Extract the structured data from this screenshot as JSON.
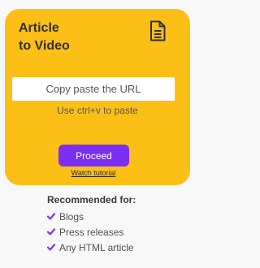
{
  "card": {
    "title_line1": "Article",
    "title_line2": "to Video",
    "icon": "document-icon",
    "url_placeholder": "Copy paste the URL",
    "hint": "Use ctrl+v to paste",
    "proceed_label": "Proceed",
    "watch_tutorial": "Watch tutorial"
  },
  "recommended": {
    "title": "Recommended for:",
    "items": [
      {
        "label": "Blogs",
        "icon": "check-icon"
      },
      {
        "label": "Press releases",
        "icon": "check-icon"
      },
      {
        "label": "Any HTML article",
        "icon": "check-icon"
      }
    ]
  },
  "colors": {
    "card_background": "#fcbf15",
    "accent_purple": "#7a2ff2",
    "page_background": "#f8f8f9"
  }
}
